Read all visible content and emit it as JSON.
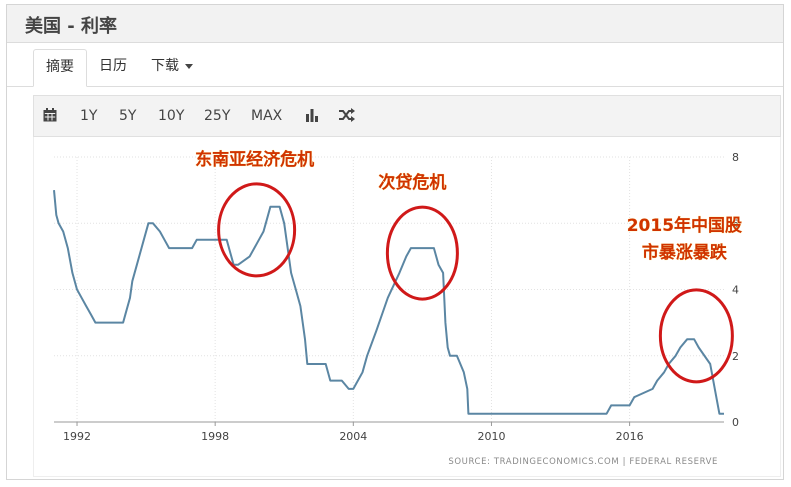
{
  "window": {
    "title": "美国 - 利率"
  },
  "tabs": [
    {
      "label": "摘要",
      "active": true
    },
    {
      "label": "日历",
      "active": false
    },
    {
      "label": "下载",
      "active": false,
      "icon": "caret-down-icon"
    }
  ],
  "toolbar": {
    "icons": [
      "calendar-icon",
      "bar-chart-icon",
      "shuffle-icon"
    ],
    "ranges": [
      "1Y",
      "5Y",
      "10Y",
      "25Y",
      "MAX"
    ]
  },
  "colors": {
    "line": "#5b86a3",
    "annotation": "#d01919",
    "annotation_text": "#d03300"
  },
  "chart_data": {
    "type": "line",
    "x_ticks": [
      "1992",
      "1998",
      "2004",
      "2010",
      "2016"
    ],
    "y_ticks": [
      "0",
      "2",
      "4",
      "6",
      "8"
    ],
    "ylim": [
      0,
      8
    ],
    "xlim": [
      1991.0,
      2020.1
    ],
    "grid": true,
    "source": "SOURCE:  TRADINGECONOMICS.COM  |  FEDERAL  RESERVE",
    "series": [
      {
        "x": [
          1991.0,
          1991.1,
          1991.2,
          1991.4,
          1991.6,
          1991.8,
          1992.0,
          1992.2,
          1992.4,
          1992.6,
          1992.8,
          1993.0,
          1993.5,
          1994.0,
          1994.1,
          1994.3,
          1994.4,
          1994.6,
          1994.8,
          1994.9,
          1995.1,
          1995.3,
          1995.6,
          1995.8,
          1996.0,
          1996.5,
          1997.0,
          1997.2,
          1997.5,
          1998.0,
          1998.5,
          1998.8,
          1999.0,
          1999.5,
          1999.7,
          1999.9,
          2000.1,
          2000.2,
          2000.4,
          2000.8,
          2001.0,
          2001.1,
          2001.3,
          2001.5,
          2001.7,
          2001.8,
          2001.9,
          2002.0,
          2002.3,
          2002.8,
          2003.0,
          2003.5,
          2003.8,
          2004.0,
          2004.4,
          2004.6,
          2005.0,
          2005.5,
          2006.0,
          2006.3,
          2006.5,
          2007.5,
          2007.7,
          2007.9,
          2008.0,
          2008.1,
          2008.2,
          2008.3,
          2008.5,
          2008.8,
          2008.95,
          2009.0,
          2015.0,
          2015.2,
          2016.0,
          2016.2,
          2017.0,
          2017.2,
          2017.5,
          2017.7,
          2018.0,
          2018.2,
          2018.5,
          2018.8,
          2019.0,
          2019.5,
          2019.7,
          2019.9,
          2020.1
        ],
        "y": [
          7.0,
          6.25,
          6.0,
          5.75,
          5.25,
          4.5,
          4.0,
          3.75,
          3.5,
          3.25,
          3.0,
          3.0,
          3.0,
          3.0,
          3.25,
          3.75,
          4.25,
          4.75,
          5.25,
          5.5,
          6.0,
          6.0,
          5.75,
          5.5,
          5.25,
          5.25,
          5.25,
          5.5,
          5.5,
          5.5,
          5.5,
          4.75,
          4.75,
          5.0,
          5.25,
          5.5,
          5.75,
          6.0,
          6.5,
          6.5,
          6.0,
          5.5,
          4.5,
          4.0,
          3.5,
          3.0,
          2.5,
          1.75,
          1.75,
          1.75,
          1.25,
          1.25,
          1.0,
          1.0,
          1.5,
          2.0,
          2.75,
          3.75,
          4.5,
          5.0,
          5.25,
          5.25,
          4.75,
          4.5,
          3.0,
          2.25,
          2.0,
          2.0,
          2.0,
          1.5,
          1.0,
          0.25,
          0.25,
          0.5,
          0.5,
          0.75,
          1.0,
          1.25,
          1.5,
          1.75,
          2.0,
          2.25,
          2.5,
          2.5,
          2.25,
          1.75,
          1.0,
          0.25,
          0.25
        ]
      }
    ],
    "annotations": [
      {
        "text": "东南亚经济危机",
        "cx": 1999.8,
        "cy": 5.8
      },
      {
        "text": "次贷危机",
        "cx": 2007.0,
        "cy": 5.1
      },
      {
        "text": "2015年中国股",
        "text2": "市暴涨暴跌",
        "cx": 2018.9,
        "cy": 2.6
      }
    ]
  }
}
